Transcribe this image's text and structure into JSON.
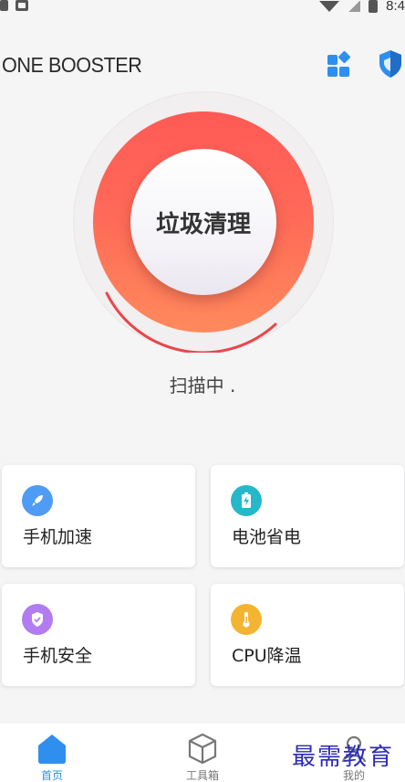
{
  "status_bar": {
    "time": "8:4",
    "icons": [
      "sim-icon",
      "notification-icon",
      "wifi-icon",
      "no-signal-icon",
      "battery-icon"
    ]
  },
  "header": {
    "brand": "ONE BOOSTER",
    "actions": [
      {
        "name": "apps-grid-icon",
        "color": "#2f8fef"
      },
      {
        "name": "shield-icon",
        "color": "#2f8fef"
      }
    ]
  },
  "scan": {
    "button_label": "垃圾清理",
    "status": "扫描中 .",
    "colors": {
      "ring_top": "#ff5a56",
      "ring_bottom": "#ff8a5c",
      "progress": "#e8474b"
    }
  },
  "tools": [
    {
      "label": "手机加速",
      "icon": "rocket-icon",
      "color": "#4e9cf5"
    },
    {
      "label": "电池省电",
      "icon": "battery-charging-icon",
      "color": "#26b8c8"
    },
    {
      "label": "手机安全",
      "icon": "shield-check-icon",
      "color": "#b27cf0"
    },
    {
      "label": "CPU降温",
      "icon": "thermometer-icon",
      "color": "#f3b531"
    }
  ],
  "bottom_nav": {
    "items": [
      {
        "label": "首页",
        "icon": "home-icon",
        "active": true
      },
      {
        "label": "工具箱",
        "icon": "box-icon",
        "active": false
      },
      {
        "label": "我的",
        "icon": "profile-icon",
        "active": false
      }
    ],
    "active_color": "#2f8fef"
  },
  "watermark": "最需教育"
}
